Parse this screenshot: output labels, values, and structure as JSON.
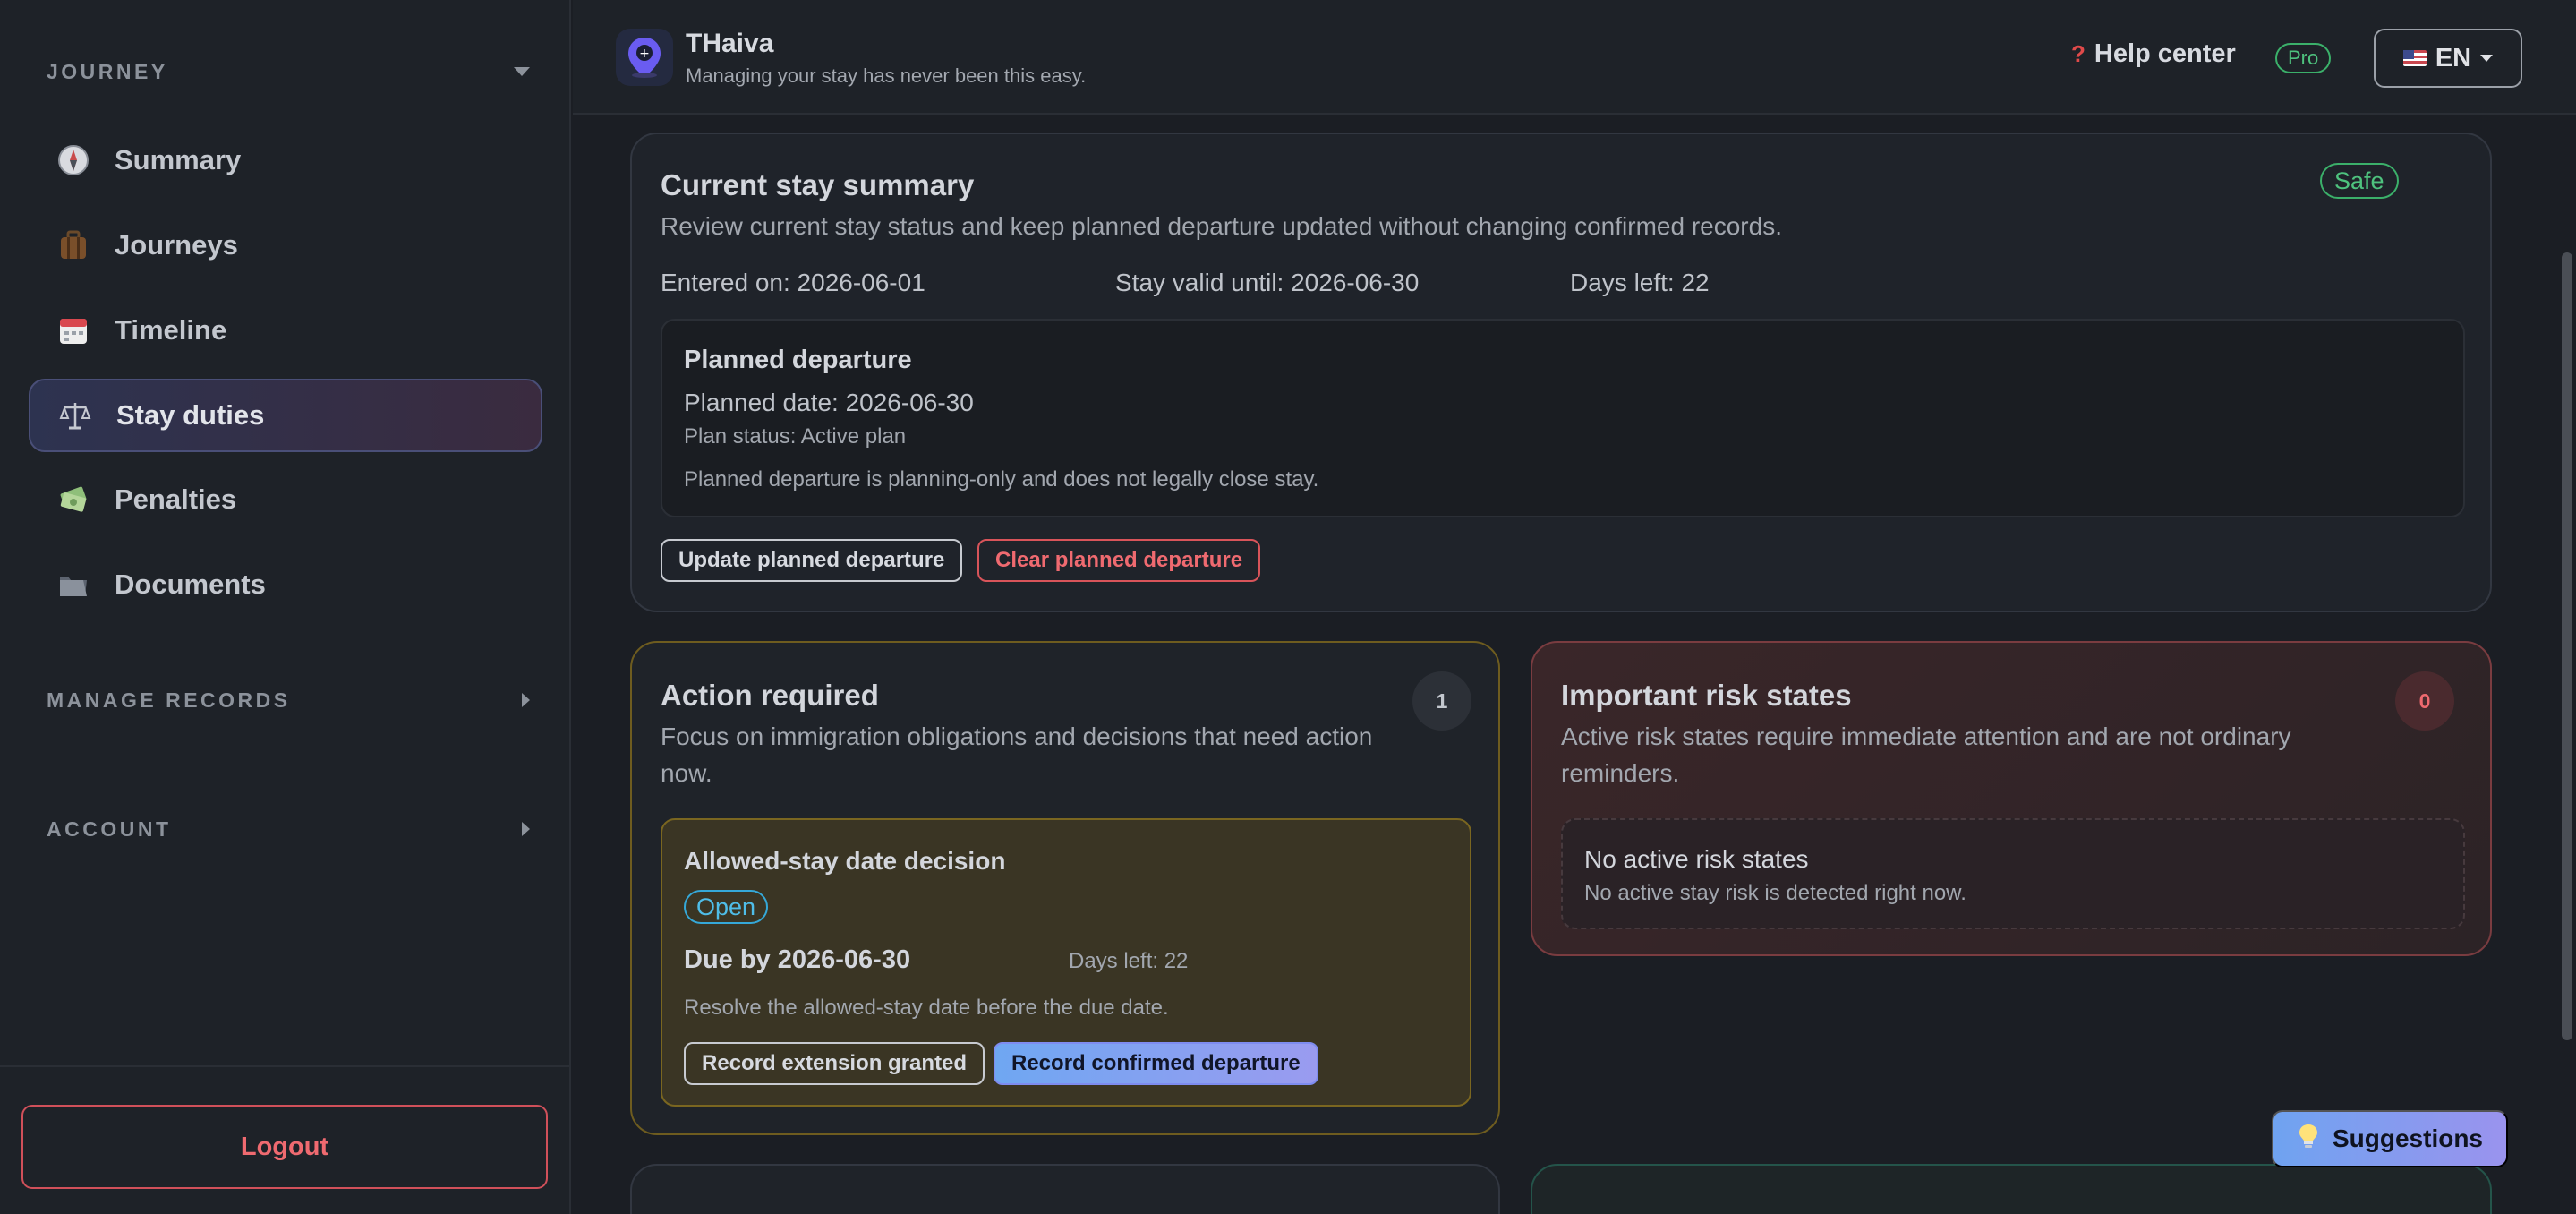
{
  "sidebar": {
    "section_journey": "JOURNEY",
    "items": [
      {
        "label": "Summary",
        "icon": "compass-icon"
      },
      {
        "label": "Journeys",
        "icon": "luggage-icon"
      },
      {
        "label": "Timeline",
        "icon": "calendar-icon"
      },
      {
        "label": "Stay duties",
        "icon": "scales-icon",
        "active": true
      },
      {
        "label": "Penalties",
        "icon": "money-icon"
      },
      {
        "label": "Documents",
        "icon": "folder-icon"
      }
    ],
    "section_manage": "MANAGE RECORDS",
    "section_account": "ACCOUNT",
    "logout": "Logout"
  },
  "header": {
    "app_name": "THaiva",
    "tagline": "Managing your stay has never been this easy.",
    "help_center": "Help center",
    "help_icon": "?",
    "pro_badge": "Pro",
    "language": "EN"
  },
  "summary": {
    "title": "Current stay summary",
    "description": "Review current stay status and keep planned departure updated without changing confirmed records.",
    "status_badge": "Safe",
    "entered_on": "Entered on: 2026-06-01",
    "valid_until": "Stay valid until: 2026-06-30",
    "days_left": "Days left: 22",
    "departure": {
      "title": "Planned departure",
      "planned_date": "Planned date: 2026-06-30",
      "plan_status": "Plan status: Active plan",
      "note": "Planned departure is planning-only and does not legally close stay."
    },
    "update_button": "Update planned departure",
    "clear_button": "Clear planned departure"
  },
  "action_required": {
    "title": "Action required",
    "count": "1",
    "description_line1": "Focus on immigration obligations and decisions that need action",
    "description_line2": "now.",
    "item": {
      "title": "Allowed-stay date decision",
      "status": "Open",
      "due": "Due by 2026-06-30",
      "days_left": "Days left: 22",
      "note": "Resolve the allowed-stay date before the due date.",
      "extension_button": "Record extension granted",
      "confirm_button": "Record confirmed departure"
    }
  },
  "risk": {
    "title": "Important risk states",
    "count": "0",
    "description_line1": "Active risk states require immediate attention and are not ordinary",
    "description_line2": "reminders.",
    "empty_title": "No active risk states",
    "empty_text": "No active stay risk is detected right now."
  },
  "suggestions_button": "Suggestions",
  "colors": {
    "accent_safe": "#4ec27e",
    "accent_danger": "#ef6a70",
    "accent_warning": "#7a6620",
    "accent_info": "#4fbde8"
  }
}
